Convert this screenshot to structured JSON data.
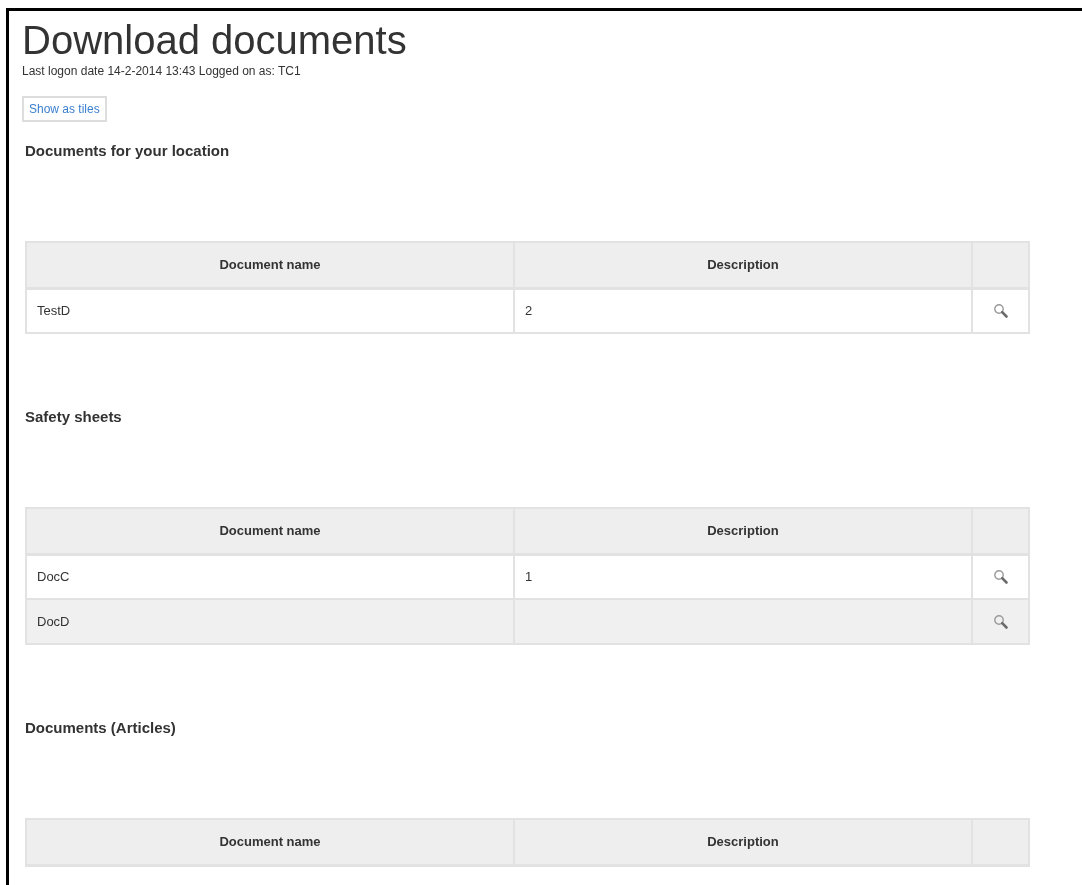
{
  "page": {
    "title": "Download documents",
    "subtitle": "Last logon date 14-2-2014 13:43 Logged on as: TC1",
    "view_button": "Show as tiles"
  },
  "sections": [
    {
      "heading": "Documents for your location",
      "columns": [
        "Document name",
        "Description"
      ],
      "rows": [
        {
          "name": "TestD",
          "description": "2"
        }
      ]
    },
    {
      "heading": "Safety sheets",
      "columns": [
        "Document name",
        "Description"
      ],
      "rows": [
        {
          "name": "DocC",
          "description": "1"
        },
        {
          "name": "DocD"
        }
      ]
    },
    {
      "heading": "Documents (Articles)",
      "columns": [
        "Document name",
        "Description"
      ]
    }
  ]
}
